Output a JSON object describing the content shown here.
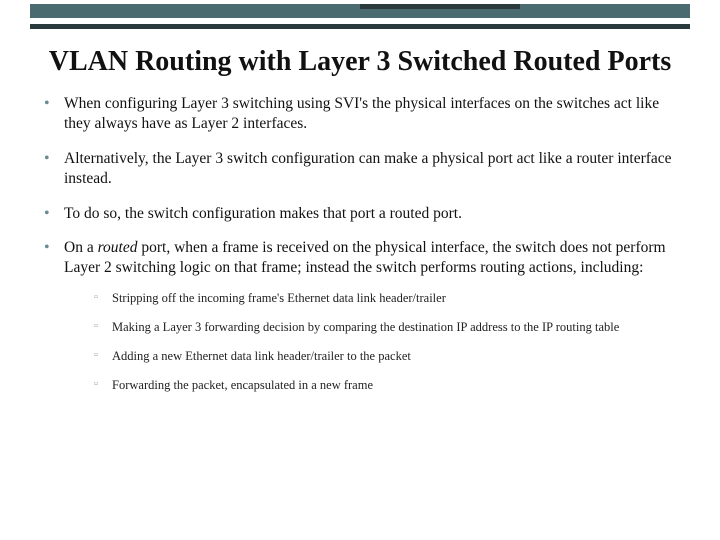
{
  "title": "VLAN Routing with Layer 3 Switched Routed Ports",
  "bullets": [
    "When configuring Layer 3 switching using SVI's the physical interfaces on the switches act like they always have as Layer 2 interfaces.",
    "Alternatively, the Layer 3 switch configuration can make a physical port act like a router interface instead.",
    "To do so, the switch configuration makes that port a routed port."
  ],
  "bullet4_pre": "On a ",
  "bullet4_em": "routed",
  "bullet4_post": " port, when a frame is received on the physical interface, the switch does not perform Layer 2 switching logic on that frame; instead the switch performs routing actions, including:",
  "sub": [
    "Stripping off the incoming frame's Ethernet data link header/trailer",
    "Making a Layer 3 forwarding decision by comparing the destination IP address to the IP routing table",
    "Adding a new Ethernet data link header/trailer to the packet",
    "Forwarding the packet, encapsulated in a new frame"
  ]
}
